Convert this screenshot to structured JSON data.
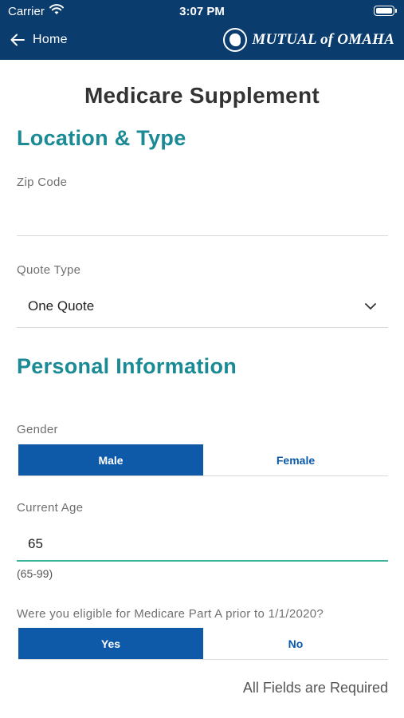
{
  "status_bar": {
    "carrier": "Carrier",
    "time": "3:07 PM"
  },
  "nav": {
    "back_label": "Home",
    "brand": "MUTUAL of OMAHA"
  },
  "page": {
    "title": "Medicare Supplement"
  },
  "sections": {
    "location": "Location & Type",
    "personal": "Personal Information"
  },
  "zip": {
    "label": "Zip Code",
    "value": ""
  },
  "quote_type": {
    "label": "Quote Type",
    "selected": "One Quote"
  },
  "gender": {
    "label": "Gender",
    "options": [
      "Male",
      "Female"
    ],
    "selected": "Male"
  },
  "age": {
    "label": "Current Age",
    "value": "65",
    "hint": "(65-99)"
  },
  "eligibility": {
    "question": "Were you eligible for Medicare Part A prior to 1/1/2020?",
    "options": [
      "Yes",
      "No"
    ],
    "selected": "Yes"
  },
  "footer": {
    "required_note": "All Fields are Required"
  },
  "colors": {
    "header": "#0b3c6e",
    "accent_teal": "#1a8a94",
    "selected_button": "#0e5aa8",
    "focus_underline": "#3bb49a"
  }
}
